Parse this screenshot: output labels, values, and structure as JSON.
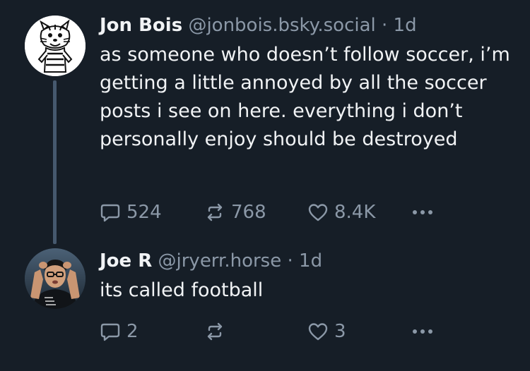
{
  "posts": [
    {
      "author": {
        "display_name": "Jon Bois",
        "handle": "@jonbois.bsky.social"
      },
      "separator": "·",
      "age": "1d",
      "text": "as someone who doesn’t follow soccer, i’m getting a little annoyed by all the soccer posts i see on here. everything i don’t personally enjoy should be destroyed",
      "stats": {
        "replies": "524",
        "reposts": "768",
        "likes": "8.4K"
      }
    },
    {
      "author": {
        "display_name": "Joe R",
        "handle": "@jryerr.horse"
      },
      "separator": "·",
      "age": "1d",
      "text": "its called football",
      "stats": {
        "replies": "2",
        "reposts": "",
        "likes": "3"
      }
    }
  ],
  "icons": {
    "reply": "speech-bubble-icon",
    "repost": "repost-arrows-icon",
    "like": "heart-icon",
    "more": "more-dots-icon"
  },
  "colors": {
    "background": "#161e27",
    "text_primary": "#f1f3f5",
    "text_secondary": "#8b98a7",
    "thread_line": "#46596e"
  }
}
